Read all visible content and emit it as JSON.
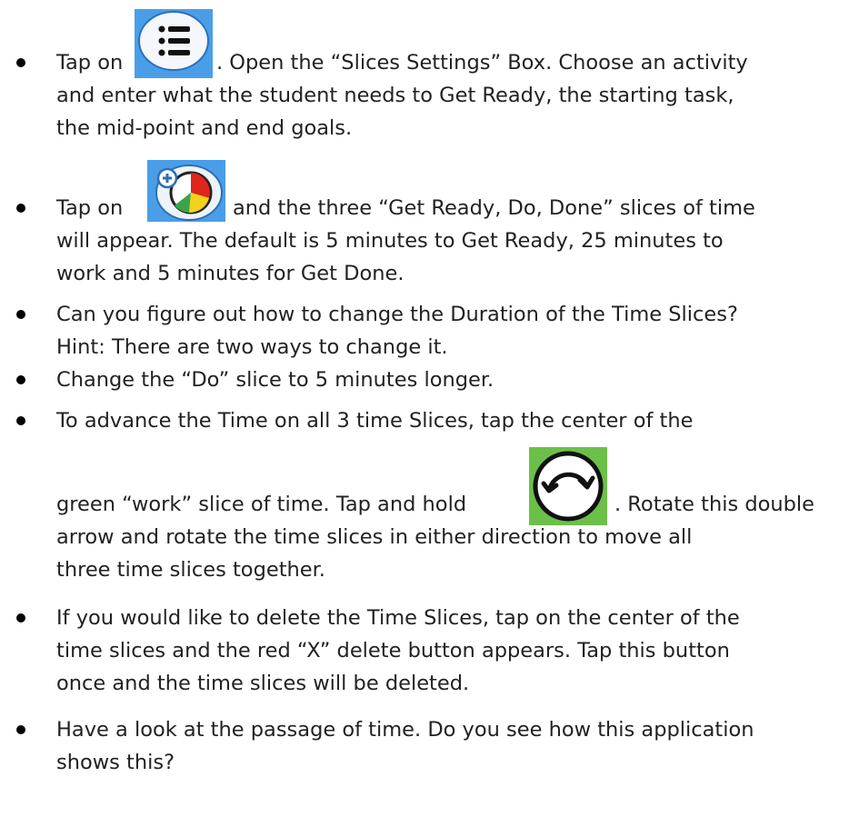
{
  "bullets": [
    {
      "lines": [
        "Tap on",
        ". Open the “Slices Settings” Box. Choose an activity",
        "and enter what the student needs to Get Ready, the starting task,",
        "the mid-point and end goals."
      ],
      "icon": "list-menu-icon"
    },
    {
      "lines": [
        "Tap on",
        "and the three “Get Ready, Do, Done” slices of time",
        "will appear. The default is 5 minutes to Get Ready, 25 minutes to",
        "work and 5 minutes for Get Done."
      ],
      "icon": "add-time-slices-icon"
    },
    {
      "lines": [
        "Can you figure out how to change the Duration of the Time Slices?",
        "Hint: There are two ways to change it."
      ]
    },
    {
      "lines": [
        "Change the “Do” slice to 5 minutes longer."
      ]
    },
    {
      "lines": [
        "To advance the Time on all 3 time Slices, tap the center of the",
        "green “work” slice of time. Tap and hold",
        ". Rotate this double",
        "arrow and rotate the time slices in either direction to move all",
        "three time slices together."
      ],
      "icon": "rotate-double-arrow-icon"
    },
    {
      "lines": [
        "If you would like to delete the Time Slices, tap on the center of the",
        "time slices and the red “X” delete button appears. Tap this button",
        "once and the time slices will be deleted."
      ]
    },
    {
      "lines": [
        "Have a look at the passage of time. Do you see how this application",
        "shows this?"
      ]
    }
  ],
  "colors": {
    "icon_blue": "#3d8ed8",
    "icon_green": "#6cc04a",
    "pie_red": "#e0251b",
    "pie_yellow": "#f2d21a",
    "pie_green": "#3aa547"
  }
}
